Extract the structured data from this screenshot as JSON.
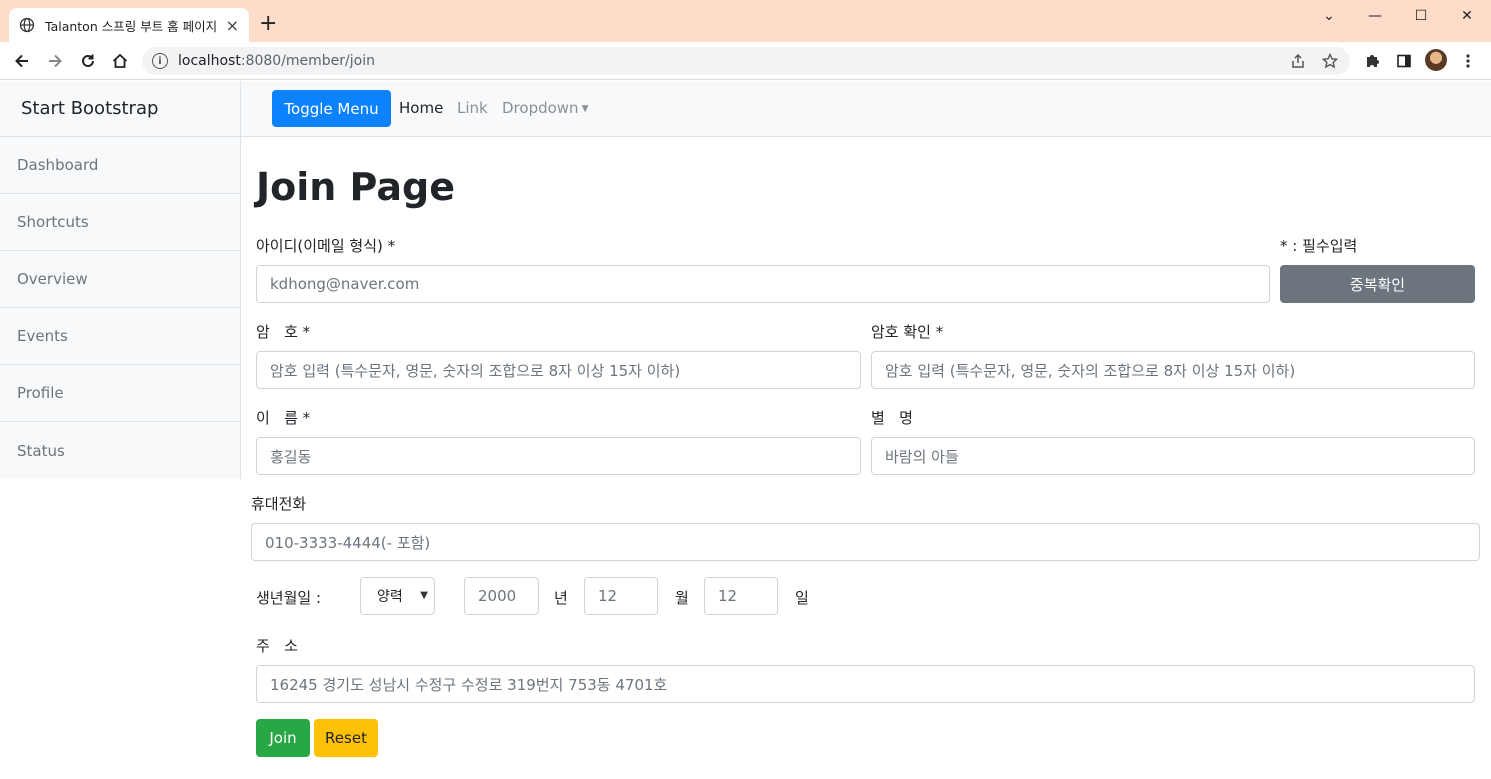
{
  "browser": {
    "tab_title": "Talanton 스프링 부트 홈 페이지",
    "tab_close": "×",
    "new_tab": "+",
    "url_host": "localhost",
    "url_path": ":8080/member/join",
    "controls": {
      "minimize": "—",
      "maximize": "☐",
      "close": "✕",
      "tabsearch": "⌄"
    }
  },
  "sidebar": {
    "heading": "Start Bootstrap",
    "items": [
      {
        "label": "Dashboard"
      },
      {
        "label": "Shortcuts"
      },
      {
        "label": "Overview"
      },
      {
        "label": "Events"
      },
      {
        "label": "Profile"
      },
      {
        "label": "Status"
      }
    ]
  },
  "topnav": {
    "toggle_label": "Toggle Menu",
    "home": "Home",
    "link": "Link",
    "dropdown": "Dropdown"
  },
  "form": {
    "title": "Join Page",
    "id_label": "아이디(이메일 형식) *",
    "required_note": "* : 필수입력",
    "id_placeholder": "kdhong@naver.com",
    "dup_check": "중복확인",
    "pw_label": "암   호 *",
    "pw_placeholder": "암호 입력 (특수문자, 영문, 숫자의 조합으로 8자 이상 15자 이하)",
    "pw_confirm_label": "암호 확인 *",
    "pw_confirm_placeholder": "암호 입력 (특수문자, 영문, 숫자의 조합으로 8자 이상 15자 이하)",
    "name_label": "이   름 *",
    "name_placeholder": "홍길동",
    "nick_label": "별   명",
    "nick_placeholder": "바람의 아들",
    "phone_label": "휴대전화",
    "phone_placeholder": "010-3333-4444(- 포함)",
    "birth_label": "생년월일 :",
    "calendar_selected": "양력",
    "year_placeholder": "2000",
    "year_unit": "년",
    "month_placeholder": "12",
    "month_unit": "월",
    "day_placeholder": "12",
    "day_unit": "일",
    "addr_label": "주   소",
    "addr_placeholder": "16245 경기도 성남시 수정구 수정로 319번지 753동 4701호",
    "join_button": "Join",
    "reset_button": "Reset"
  },
  "colors": {
    "primary": "#0d82ff",
    "secondary": "#6c757d",
    "success": "#28a745",
    "warning": "#ffc107",
    "tabbar": "#fedcca"
  }
}
